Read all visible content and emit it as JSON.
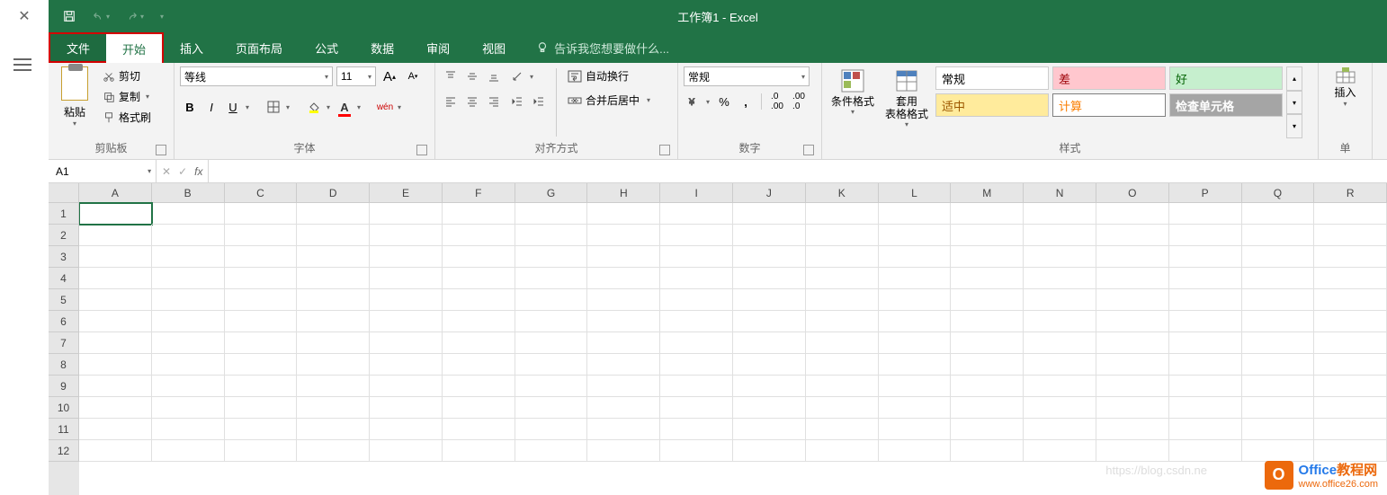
{
  "title": "工作簿1 - Excel",
  "tabs": {
    "file": "文件",
    "home": "开始",
    "insert": "插入",
    "layout": "页面布局",
    "formulas": "公式",
    "data": "数据",
    "review": "审阅",
    "view": "视图"
  },
  "tellme": "告诉我您想要做什么...",
  "groups": {
    "clipboard": "剪贴板",
    "font": "字体",
    "alignment": "对齐方式",
    "number": "数字",
    "styles": "样式",
    "cells": "单"
  },
  "clipboard": {
    "paste": "粘贴",
    "cut": "剪切",
    "copy": "复制",
    "painter": "格式刷"
  },
  "font": {
    "name": "等线",
    "size": "11",
    "wen": "wén"
  },
  "alignment": {
    "wrap": "自动换行",
    "merge": "合并后居中"
  },
  "number": {
    "format": "常规"
  },
  "styles": {
    "condfmt": "条件格式",
    "tablestyle": "套用\n表格格式",
    "normal": "常规",
    "bad": "差",
    "good": "好",
    "neutral": "适中",
    "calc": "计算",
    "check": "检查单元格"
  },
  "cells": {
    "insert": "插入"
  },
  "namebox": "A1",
  "columns": [
    "A",
    "B",
    "C",
    "D",
    "E",
    "F",
    "G",
    "H",
    "I",
    "J",
    "K",
    "L",
    "M",
    "N",
    "O",
    "P",
    "Q",
    "R"
  ],
  "rows": [
    "1",
    "2",
    "3",
    "4",
    "5",
    "6",
    "7",
    "8",
    "9",
    "10",
    "11",
    "12"
  ],
  "watermark": {
    "brand": "Office教程网",
    "url": "www.office26.com"
  },
  "faded_url": "https://blog.csdn.ne"
}
